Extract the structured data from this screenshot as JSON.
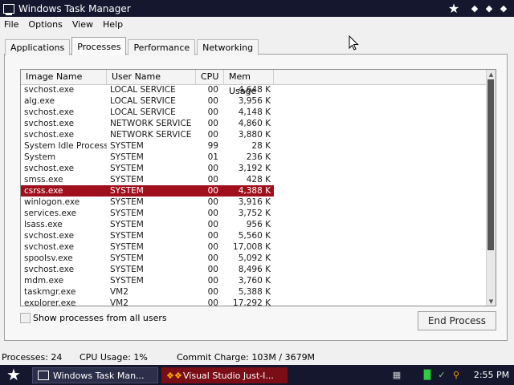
{
  "window": {
    "title": "Windows Task Manager",
    "controls": [
      "star",
      "pin",
      "minimize",
      "close"
    ]
  },
  "menu": [
    "File",
    "Options",
    "View",
    "Help"
  ],
  "tabs": [
    {
      "label": "Applications",
      "active": false
    },
    {
      "label": "Processes",
      "active": true
    },
    {
      "label": "Performance",
      "active": false
    },
    {
      "label": "Networking",
      "active": false
    }
  ],
  "processes": {
    "columns": [
      "Image Name",
      "User Name",
      "CPU",
      "Mem Usage"
    ],
    "rows": [
      {
        "name": "svchost.exe",
        "user": "LOCAL SERVICE",
        "cpu": "00",
        "mem": "4,648 K"
      },
      {
        "name": "alg.exe",
        "user": "LOCAL SERVICE",
        "cpu": "00",
        "mem": "3,956 K"
      },
      {
        "name": "svchost.exe",
        "user": "LOCAL SERVICE",
        "cpu": "00",
        "mem": "4,148 K"
      },
      {
        "name": "svchost.exe",
        "user": "NETWORK SERVICE",
        "cpu": "00",
        "mem": "4,860 K"
      },
      {
        "name": "svchost.exe",
        "user": "NETWORK SERVICE",
        "cpu": "00",
        "mem": "3,880 K"
      },
      {
        "name": "System Idle Process",
        "user": "SYSTEM",
        "cpu": "99",
        "mem": "28 K"
      },
      {
        "name": "System",
        "user": "SYSTEM",
        "cpu": "01",
        "mem": "236 K"
      },
      {
        "name": "svchost.exe",
        "user": "SYSTEM",
        "cpu": "00",
        "mem": "3,192 K"
      },
      {
        "name": "smss.exe",
        "user": "SYSTEM",
        "cpu": "00",
        "mem": "428 K"
      },
      {
        "name": "csrss.exe",
        "user": "SYSTEM",
        "cpu": "00",
        "mem": "4,388 K",
        "selected": true
      },
      {
        "name": "winlogon.exe",
        "user": "SYSTEM",
        "cpu": "00",
        "mem": "3,916 K"
      },
      {
        "name": "services.exe",
        "user": "SYSTEM",
        "cpu": "00",
        "mem": "3,752 K"
      },
      {
        "name": "lsass.exe",
        "user": "SYSTEM",
        "cpu": "00",
        "mem": "956 K"
      },
      {
        "name": "svchost.exe",
        "user": "SYSTEM",
        "cpu": "00",
        "mem": "5,560 K"
      },
      {
        "name": "svchost.exe",
        "user": "SYSTEM",
        "cpu": "00",
        "mem": "17,008 K"
      },
      {
        "name": "spoolsv.exe",
        "user": "SYSTEM",
        "cpu": "00",
        "mem": "5,092 K"
      },
      {
        "name": "svchost.exe",
        "user": "SYSTEM",
        "cpu": "00",
        "mem": "8,496 K"
      },
      {
        "name": "mdm.exe",
        "user": "SYSTEM",
        "cpu": "00",
        "mem": "3,760 K"
      },
      {
        "name": "taskmgr.exe",
        "user": "VM2",
        "cpu": "00",
        "mem": "5,388 K"
      },
      {
        "name": "explorer.exe",
        "user": "VM2",
        "cpu": "00",
        "mem": "17,292 K"
      }
    ]
  },
  "show_all": {
    "label": "Show processes from all users",
    "checked": false
  },
  "end_process_label": "End Process",
  "status": {
    "processes": "Processes: 24",
    "cpu": "CPU Usage: 1%",
    "commit": "Commit Charge: 103M / 3679M"
  },
  "taskbar": {
    "items": [
      {
        "label": "Windows Task Man...",
        "icon": "task-manager-icon",
        "active": true
      },
      {
        "label": "Visual Studio Just-I...",
        "icon": "debugger-icon",
        "active": false
      }
    ],
    "clock": "2:55 PM"
  },
  "colors": {
    "titlebar": "#15172e",
    "selection": "#a0101c",
    "taskbar_alert": "#7a0d15"
  }
}
